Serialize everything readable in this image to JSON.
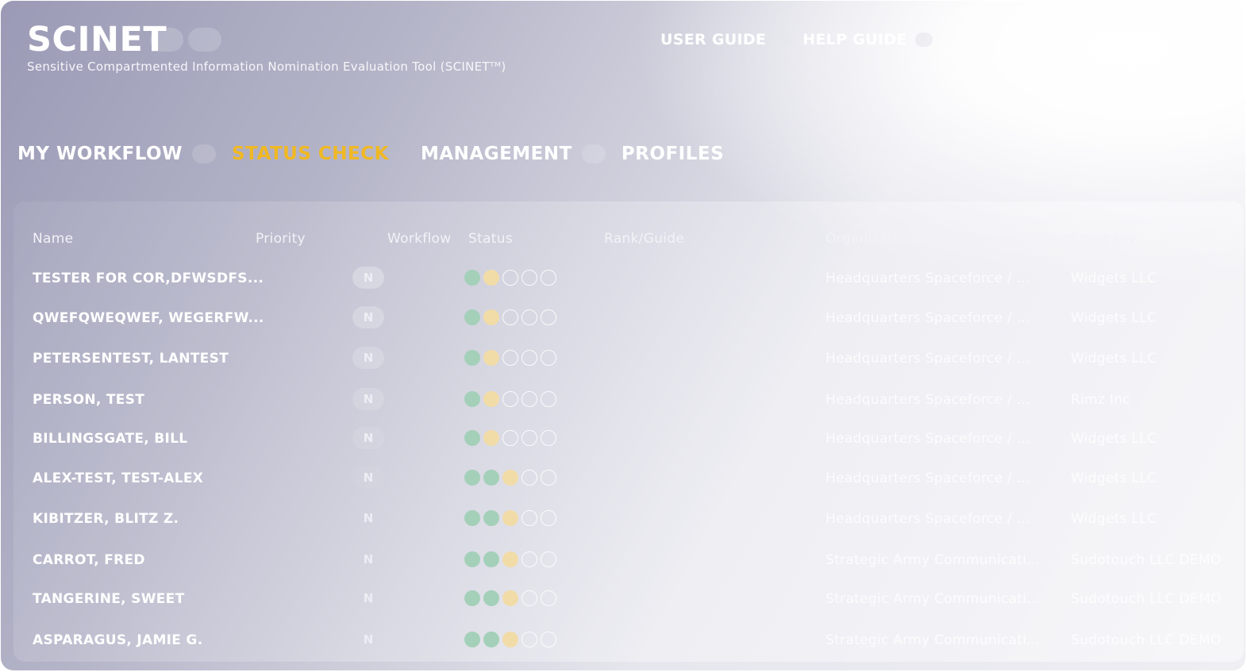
{
  "header": {
    "title": "SCINET",
    "subtitle": "Sensitive Compartmented Information Nomination Evaluation Tool (SCINETᵀᴹ)",
    "links": [
      "USER GUIDE",
      "HELP GUIDE"
    ]
  },
  "nav": {
    "items": [
      "MY WORKFLOW",
      "STATUS CHECK",
      "MANAGEMENT",
      "PROFILES"
    ],
    "active": "STATUS CHECK"
  },
  "table": {
    "columns": [
      "Name",
      "Priority",
      "Workflow",
      "Status",
      "Rank/Guide",
      "Organization",
      "Company"
    ],
    "rows": [
      {
        "name": "TESTER FOR COR,DFWSDFS...",
        "workflow": "N",
        "status": [
          "green",
          "yellow",
          "empty",
          "empty",
          "empty"
        ],
        "organization": "Headquarters Spaceforce / ...",
        "company": "Widgets LLC"
      },
      {
        "name": "QWEFQWEQWEF, WEGERFW...",
        "workflow": "N",
        "status": [
          "green",
          "yellow",
          "empty",
          "empty",
          "empty"
        ],
        "organization": "Headquarters Spaceforce / ...",
        "company": "Widgets LLC"
      },
      {
        "name": "PETERSENTEST, LANTEST",
        "workflow": "N",
        "status": [
          "green",
          "yellow",
          "empty",
          "empty",
          "empty"
        ],
        "organization": "Headquarters Spaceforce / ...",
        "company": "Widgets LLC"
      },
      {
        "name": "PERSON, TEST",
        "workflow": "N",
        "status": [
          "green",
          "yellow",
          "empty",
          "empty",
          "empty"
        ],
        "organization": "Headquarters Spaceforce / ...",
        "company": "Rimz Inc"
      },
      {
        "name": "BILLINGSGATE, BILL",
        "workflow": "N",
        "status": [
          "green",
          "yellow",
          "empty",
          "empty",
          "empty"
        ],
        "organization": "Headquarters Spaceforce / ...",
        "company": "Widgets LLC"
      },
      {
        "name": "ALEX-TEST, TEST-ALEX",
        "workflow": "N",
        "status": [
          "green",
          "green",
          "yellow",
          "empty",
          "empty"
        ],
        "organization": "Headquarters Spaceforce / ...",
        "company": "Widgets LLC"
      },
      {
        "name": "KIBITZER, BLITZ Z.",
        "workflow": "N",
        "status": [
          "green",
          "green",
          "yellow",
          "empty",
          "empty"
        ],
        "organization": "Headquarters Spaceforce / ...",
        "company": "Widgets LLC"
      },
      {
        "name": "CARROT, FRED",
        "workflow": "N",
        "status": [
          "green",
          "green",
          "yellow",
          "empty",
          "empty"
        ],
        "organization": "Strategic Army Communicati...",
        "company": "Sudotouch LLC DEMO"
      },
      {
        "name": "TANGERINE, SWEET",
        "workflow": "N",
        "status": [
          "green",
          "green",
          "yellow",
          "empty",
          "empty"
        ],
        "organization": "Strategic Army Communicati...",
        "company": "Sudotouch LLC DEMO"
      },
      {
        "name": "ASPARAGUS, JAMIE G.",
        "workflow": "N",
        "status": [
          "green",
          "green",
          "yellow",
          "empty",
          "empty"
        ],
        "organization": "Strategic Army Communicati...",
        "company": "Sudotouch LLC DEMO"
      }
    ]
  },
  "colors": {
    "active_nav": "#f0b823",
    "status_done": "#a4d0b9",
    "status_current": "#f1dca8"
  }
}
